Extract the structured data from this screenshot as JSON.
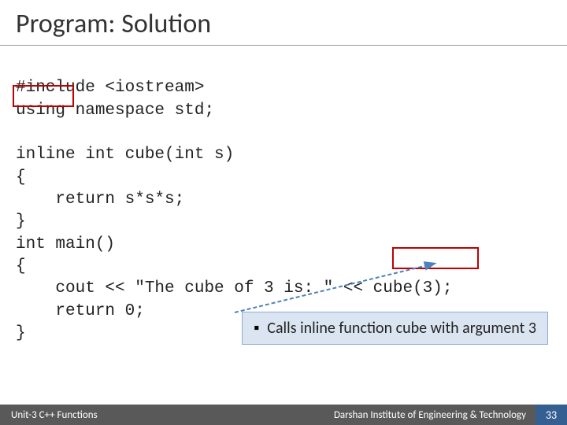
{
  "title": "Program: Solution",
  "code": {
    "l1": "#include <iostream>",
    "l2": "using namespace std;",
    "l3": "",
    "l4": "inline int cube(int s)",
    "l5": "{",
    "l6": "    return s*s*s;",
    "l7": "}",
    "l8": "int main()",
    "l9": "{",
    "l10": "    cout << \"The cube of 3 is: \" << cube(3);",
    "l11": "    return 0;",
    "l12": "}"
  },
  "callout": "Calls inline function cube with argument 3",
  "footer": {
    "unit": "Unit-3 C++ Functions",
    "inst": "Darshan Institute of Engineering & Technology",
    "num": "33"
  },
  "highlight1_target": "inline",
  "highlight2_target": "cube(3);"
}
